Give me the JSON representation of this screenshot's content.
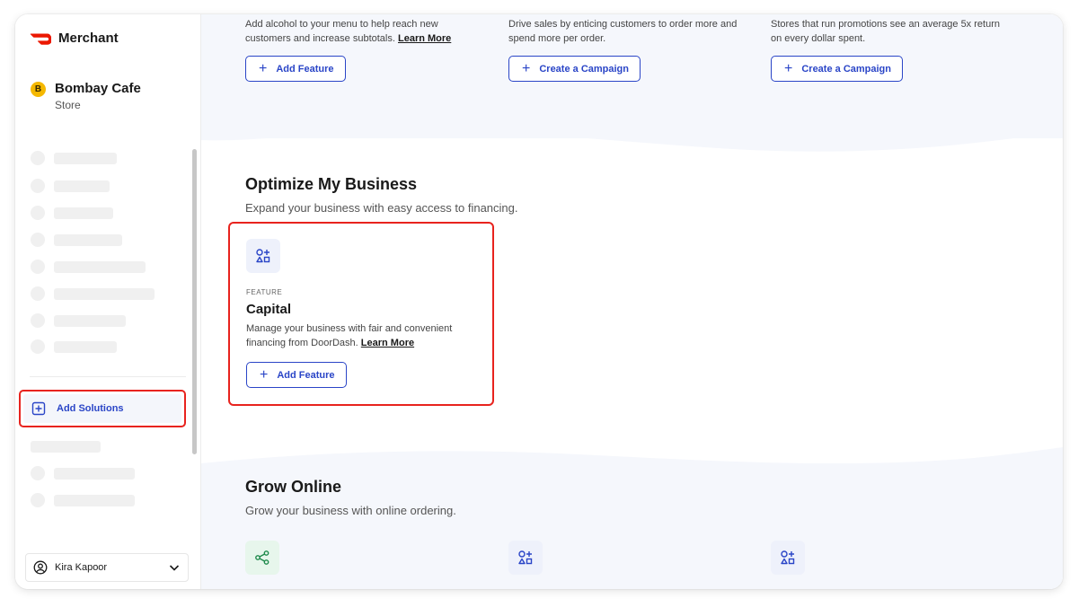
{
  "brand": {
    "name": "Merchant",
    "accent": "#eb1700"
  },
  "store": {
    "initial": "B",
    "name": "Bombay Cafe",
    "type": "Store"
  },
  "sidebar": {
    "add_solutions_label": "Add Solutions",
    "user_name": "Kira Kapoor",
    "icons": {
      "add": "plus-square-icon",
      "user": "user-circle-icon",
      "expand": "chevron-down-icon"
    }
  },
  "promos": [
    {
      "text": "Add alcohol to your menu to help reach new customers and increase subtotals.",
      "link": "Learn More",
      "button": "Add Feature"
    },
    {
      "text": "Drive sales by enticing customers to order more and spend more per order.",
      "link": "",
      "button": "Create a Campaign"
    },
    {
      "text": "Stores that run promotions see an average 5x return on every dollar spent.",
      "link": "",
      "button": "Create a Campaign"
    }
  ],
  "optimize": {
    "title": "Optimize My Business",
    "subtitle": "Expand your business with easy access to financing.",
    "card": {
      "eyebrow": "FEATURE",
      "title": "Capital",
      "desc": "Manage your business with fair and convenient financing from DoorDash.",
      "link": "Learn More",
      "button": "Add Feature",
      "icon": "shapes-icon"
    }
  },
  "grow": {
    "title": "Grow Online",
    "subtitle": "Grow your business with online ordering.",
    "icons": [
      "share-icon",
      "shapes-icon",
      "shapes-icon"
    ]
  },
  "colors": {
    "primary": "#2a45c7",
    "highlight": "#e8231e",
    "band": "#f5f7fc"
  }
}
